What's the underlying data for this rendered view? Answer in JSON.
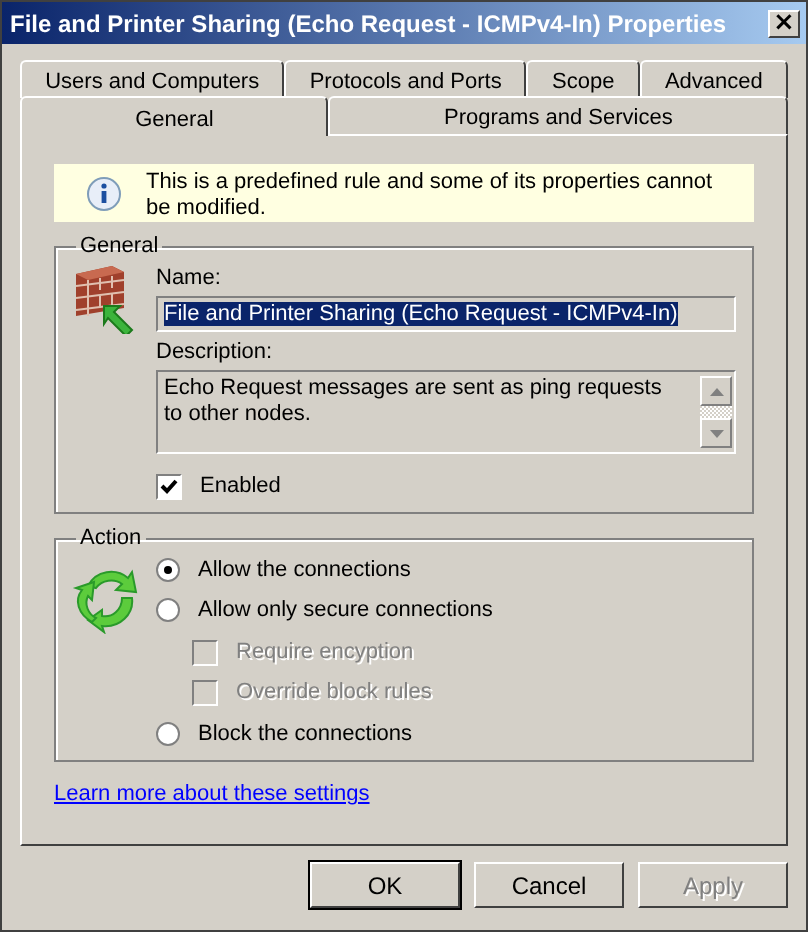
{
  "window": {
    "title": "File and Printer Sharing (Echo Request - ICMPv4-In) Properties",
    "close": "×"
  },
  "tabs": {
    "back_row": [
      {
        "label": "Users and Computers",
        "selected": false
      },
      {
        "label": "Protocols and Ports",
        "selected": false
      },
      {
        "label": "Scope",
        "selected": false
      },
      {
        "label": "Advanced",
        "selected": false
      }
    ],
    "front_row": [
      {
        "label": "General",
        "selected": true
      },
      {
        "label": "Programs and Services",
        "selected": false
      }
    ]
  },
  "notice": {
    "text": "This is a predefined rule and some of its properties cannot be modified."
  },
  "general": {
    "title": "General",
    "name_label": "Name:",
    "name_value": "File and Printer Sharing (Echo Request - ICMPv4-In)",
    "name_text_selected": true,
    "description_label": "Description:",
    "description": "Echo Request messages are sent as ping requests to other nodes.",
    "enabled": {
      "label": "Enabled",
      "checked": true
    }
  },
  "action": {
    "title": "Action",
    "options": [
      {
        "label": "Allow the connections",
        "selected": true
      },
      {
        "label": "Allow only secure connections",
        "selected": false,
        "children": [
          {
            "label": "Require encyption",
            "checked": false,
            "disabled": true
          },
          {
            "label": "Override block rules",
            "checked": false,
            "disabled": true
          }
        ]
      },
      {
        "label": "Block the connections",
        "selected": false
      }
    ]
  },
  "link": "Learn more about these settings",
  "buttons": [
    {
      "label": "OK",
      "default": true,
      "disabled": false
    },
    {
      "label": "Cancel",
      "default": false,
      "disabled": false
    },
    {
      "label": "Apply",
      "default": false,
      "disabled": true
    }
  ]
}
